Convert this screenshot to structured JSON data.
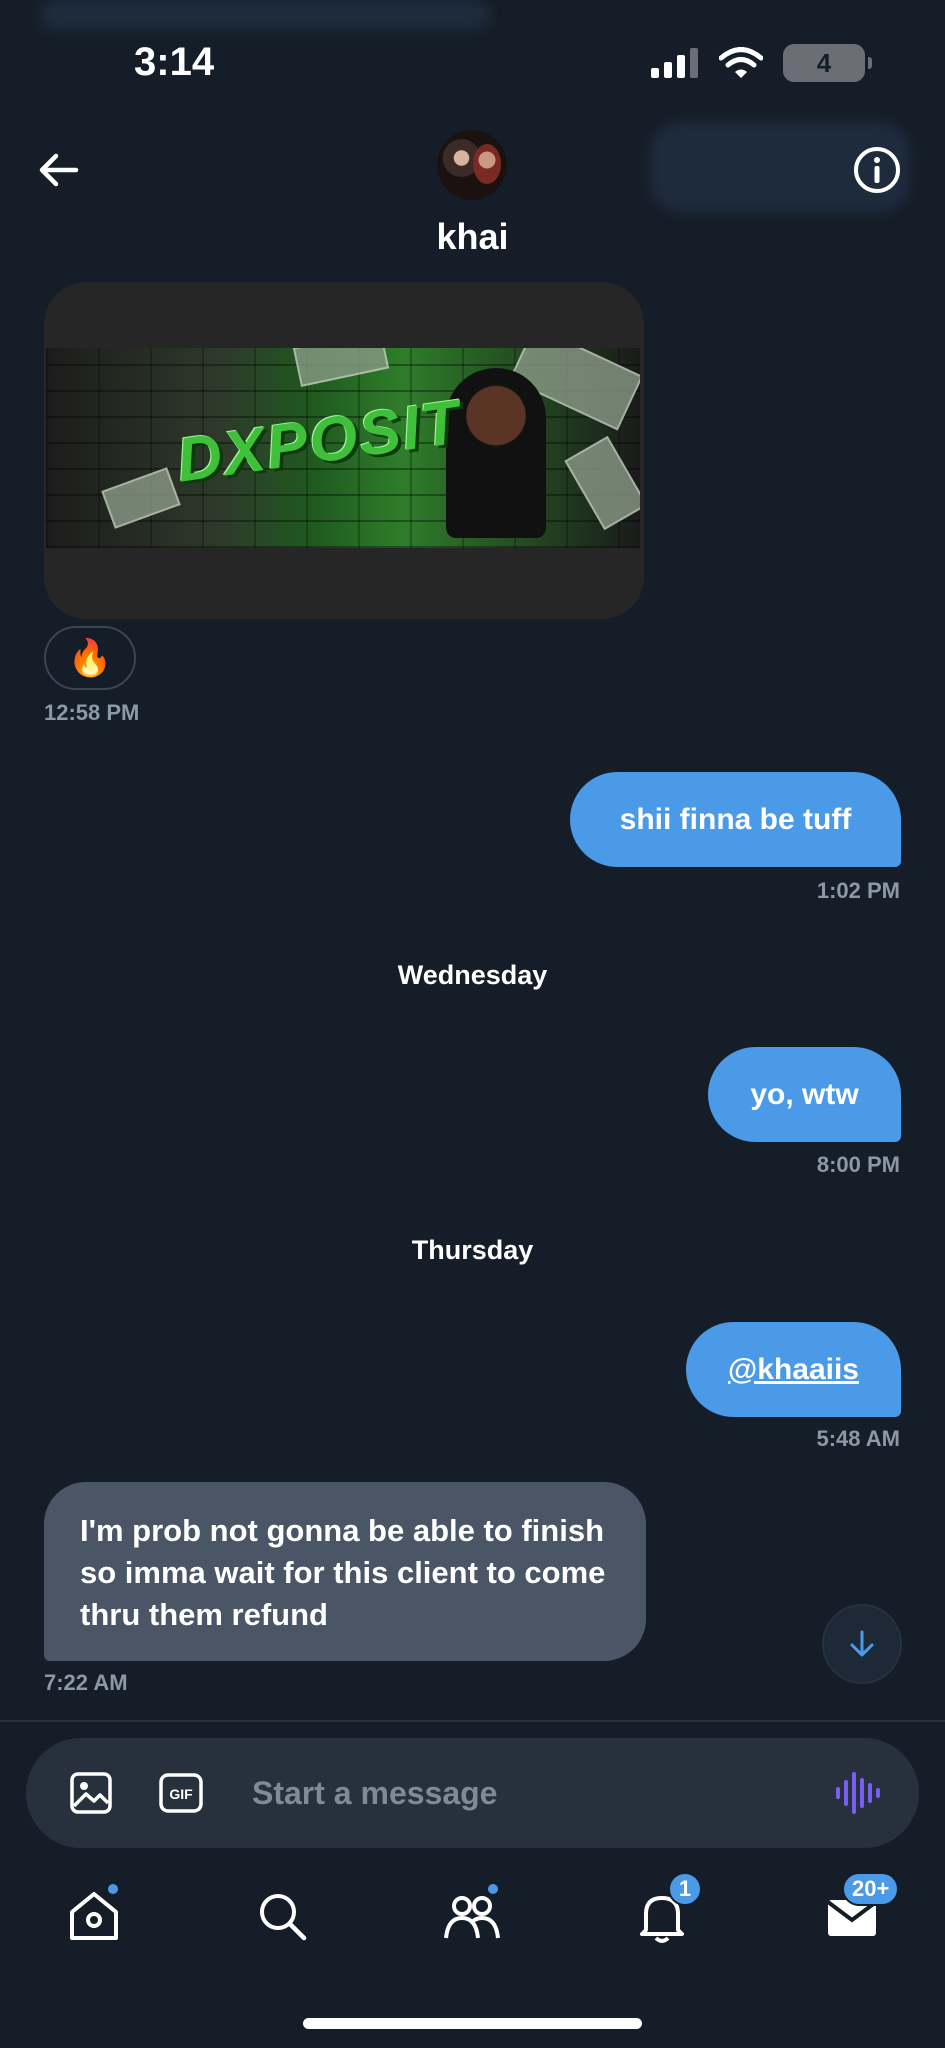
{
  "status_bar": {
    "time": "3:14",
    "battery": "4"
  },
  "header": {
    "contact_name": "khai"
  },
  "messages": {
    "m1_reaction": "🔥",
    "m1_banner_text": "DXPOSIT",
    "m1_time": "12:58 PM",
    "m2_text": "shii finna be tuff",
    "m2_time": "1:02 PM",
    "day1": "Wednesday",
    "m3_text": "yo, wtw",
    "m3_time": "8:00 PM",
    "day2": "Thursday",
    "m4_text": "@khaaiis",
    "m4_time": "5:48 AM",
    "m5_text": "I'm prob not gonna be able to finish so imma wait for this client to come thru them refund",
    "m5_time": "7:22 AM"
  },
  "composer": {
    "placeholder": "Start a message",
    "gif_label": "GIF"
  },
  "tab_bar": {
    "notifications_count": "1",
    "messages_count": "20+"
  },
  "colors": {
    "background": "#151d28",
    "accent": "#4a9ae8",
    "incoming_bubble": "#4a5665",
    "voice_icon": "#7b5cf0"
  }
}
